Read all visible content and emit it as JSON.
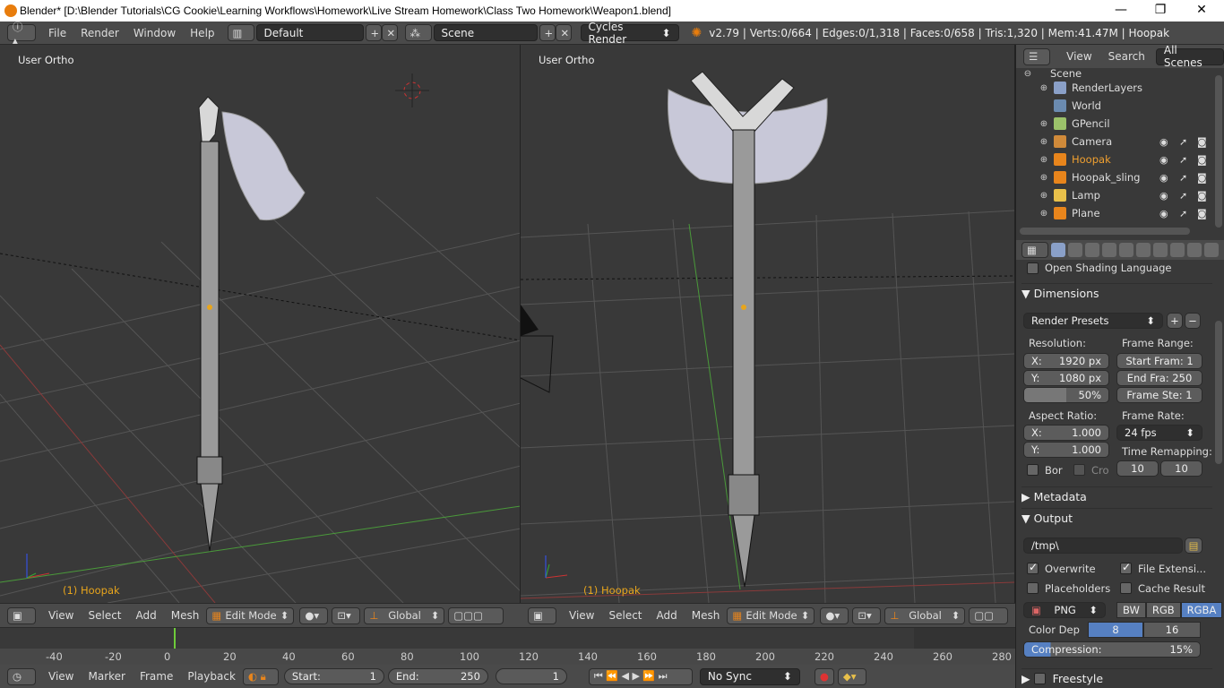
{
  "window": {
    "title": "Blender* [D:\\Blender Tutorials\\CG Cookie\\Learning Workflows\\Homework\\Live Stream Homework\\Class Two Homework\\Weapon1.blend]",
    "minimize": "—",
    "maximize": "❐",
    "close": "✕"
  },
  "infobar": {
    "menus": [
      "File",
      "Render",
      "Window",
      "Help"
    ],
    "layout": "Default",
    "scene": "Scene",
    "engine": "Cycles Render",
    "stats": "v2.79 | Verts:0/664 | Edges:0/1,318 | Faces:0/658 | Tris:1,320 | Mem:41.47M | Hoopak"
  },
  "viewport_left": {
    "label": "User Ortho",
    "object": "(1) Hoopak"
  },
  "viewport_right": {
    "label": "User Ortho",
    "object": "(1) Hoopak"
  },
  "view3d_header": {
    "menus": [
      "View",
      "Select",
      "Add",
      "Mesh"
    ],
    "mode": "Edit Mode",
    "orientation": "Global"
  },
  "timeline": {
    "ticks": [
      "-40",
      "-20",
      "0",
      "20",
      "40",
      "60",
      "80",
      "100",
      "120",
      "140",
      "160",
      "180",
      "200",
      "220",
      "240",
      "260",
      "280"
    ],
    "menus": [
      "View",
      "Marker",
      "Frame",
      "Playback"
    ],
    "start_label": "Start:",
    "start": "1",
    "end_label": "End:",
    "end": "250",
    "current": "1",
    "sync": "No Sync"
  },
  "outliner": {
    "menus": [
      "View",
      "Search"
    ],
    "filter": "All Scenes",
    "root": "Scene",
    "items": [
      {
        "name": "RenderLayers",
        "color": "#8aa0c8"
      },
      {
        "name": "World",
        "color": "#6b8bb0"
      },
      {
        "name": "GPencil",
        "color": "#9bc26a"
      },
      {
        "name": "Camera",
        "color": "#d08a3a"
      },
      {
        "name": "Hoopak",
        "color": "#e8851c"
      },
      {
        "name": "Hoopak_sling",
        "color": "#e8851c"
      },
      {
        "name": "Lamp",
        "color": "#e8c04a"
      },
      {
        "name": "Plane",
        "color": "#e8851c"
      }
    ]
  },
  "properties": {
    "osl": "Open Shading Language",
    "dimensions": "Dimensions",
    "presets": "Render Presets",
    "resolution": "Resolution:",
    "res_x_label": "X:",
    "res_x": "1920 px",
    "res_y_label": "Y:",
    "res_y": "1080 px",
    "res_pct": "50%",
    "frame_range": "Frame Range:",
    "start_frame": "Start Fram: 1",
    "end_frame": "End Fra: 250",
    "frame_step": "Frame Ste: 1",
    "aspect": "Aspect Ratio:",
    "aspect_x_label": "X:",
    "aspect_x": "1.000",
    "aspect_y_label": "Y:",
    "aspect_y": "1.000",
    "frame_rate": "Frame Rate:",
    "fps": "24 fps",
    "remap": "Time Remapping:",
    "remap_old": "10",
    "remap_new": "10",
    "border": "Bor",
    "crop": "Cro",
    "metadata": "Metadata",
    "output": "Output",
    "path": "/tmp\\",
    "overwrite": "Overwrite",
    "file_ext": "File Extensi...",
    "placeholders": "Placeholders",
    "cache": "Cache Result",
    "format": "PNG",
    "bw": "BW",
    "rgb": "RGB",
    "rgba": "RGBA",
    "color_depth": "Color Dep",
    "depth_8": "8",
    "depth_16": "16",
    "compression": "Compression:",
    "compression_val": "15%",
    "freestyle": "Freestyle"
  }
}
